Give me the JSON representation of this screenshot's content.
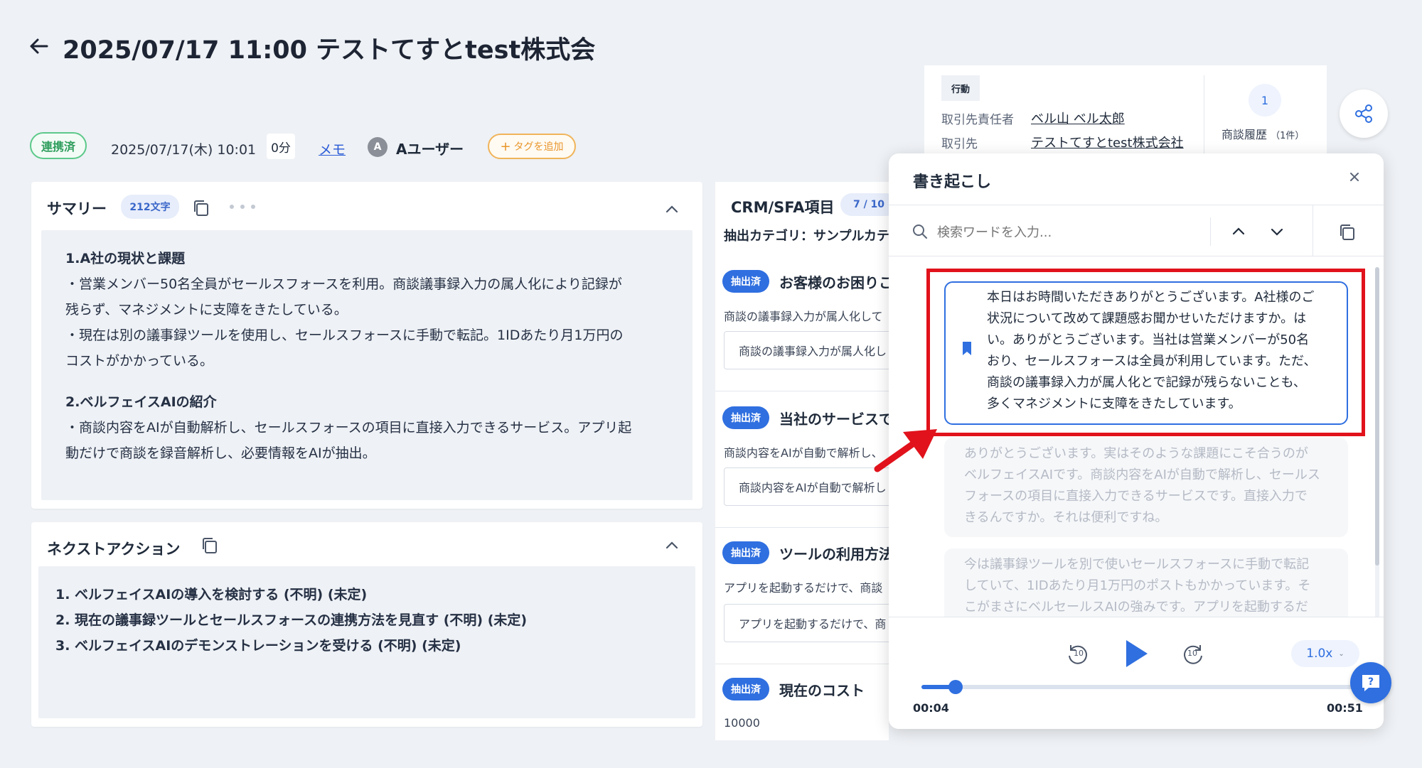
{
  "header": {
    "title": "2025/07/17 11:00 テストてすとtest株式会"
  },
  "meta": {
    "status": "連携済",
    "datetime": "2025/07/17(木) 10:01",
    "duration": "0分",
    "memo_label": "メモ",
    "user_initial": "A",
    "user_name": "Aユーザー",
    "add_tag_label": "タグを追加"
  },
  "summary": {
    "title": "サマリー",
    "char_count": "212文字",
    "sections": [
      {
        "heading": "1.A社の現状と課題",
        "lines": [
          "・営業メンバー50名全員がセールスフォースを利用。商談議事録入力の属人化により記録が",
          "残らず、マネジメントに支障をきたしている。",
          "・現在は別の議事録ツールを使用し、セールスフォースに手動で転記。1IDあたり月1万円の",
          "コストがかかっている。"
        ]
      },
      {
        "heading": "2.ベルフェイスAIの紹介",
        "lines": [
          "・商談内容をAIが自動解析し、セールスフォースの項目に直接入力できるサービス。アプリ起",
          "動だけで商談を録音解析し、必要情報をAIが抽出。"
        ]
      }
    ]
  },
  "next_action": {
    "title": "ネクストアクション",
    "items": [
      "1. ベルフェイスAIの導入を検討する (不明) (未定)",
      "2. 現在の議事録ツールとセールスフォースの連携方法を見直す (不明) (未定)",
      "3. ベルフェイスAIのデモンストレーションを受ける (不明) (未定)"
    ]
  },
  "crm": {
    "title": "CRM/SFA項目",
    "count": "7 / 10",
    "category": "抽出カテゴリ：サンプルカテ",
    "items": [
      {
        "badge": "抽出済",
        "title": "お客様のお困りこ",
        "desc": "商談の議事録入力が属人化して",
        "value": "商談の議事録入力が属人化し"
      },
      {
        "badge": "抽出済",
        "title": "当社のサービスで",
        "desc": "商談内容をAIが自動で解析し、",
        "value": "商談内容をAIが自動で解析し"
      },
      {
        "badge": "抽出済",
        "title": "ツールの利用方法",
        "desc": "アプリを起動するだけで、商談",
        "value": "アプリを起動するだけで、商"
      },
      {
        "badge": "抽出済",
        "title": "現在のコスト",
        "desc": "10000"
      }
    ]
  },
  "info": {
    "action_tag": "行動",
    "rows": [
      {
        "label": "取引先責任者",
        "value": "ベル山 ベル太郎"
      },
      {
        "label": "取引先",
        "value": "テストてすとtest株式会社"
      }
    ],
    "history_count": "1",
    "history_label": "商談履歴",
    "history_sub": "（1件）"
  },
  "transcript": {
    "title": "書き起こし",
    "search_placeholder": "検索ワードを入力...",
    "active_lines": [
      "本日はお時間いただきありがとうございます。A社様のご",
      "状況について改めて課題感お聞かせいただけますか。は",
      "い。ありがとうございます。当社は営業メンバーが50名",
      "おり、セールスフォースは全員が利用しています。ただ、",
      "商談の議事録入力が属人化とで記録が残らないことも、",
      "多くマネジメントに支障をきたしています。"
    ],
    "faded_1": [
      "ありがとうございます。実はそのような課題にこそ合うのが",
      "ベルフェイスAIです。商談内容をAIが自動で解析し、セールス",
      "フォースの項目に直接入力できるサービスです。直接入力で",
      "きるんですか。それは便利ですね。"
    ],
    "faded_2": [
      "今は議事録ツールを別で使いセールスフォースに手動で転記",
      "していて、1IDあたり月1万円のポストもかかっています。そ",
      "こがまさにベルセールスAIの強みです。アプリを起動するだ"
    ],
    "player": {
      "speed": "1.0x",
      "current": "00:04",
      "total": "00:51",
      "skip_seconds": "10",
      "progress": 0.078
    }
  },
  "colors": {
    "accent": "#2f6fe0",
    "highlight": "#e1121b",
    "status_green": "#2f9e5d",
    "tag_orange": "#e8962b"
  }
}
